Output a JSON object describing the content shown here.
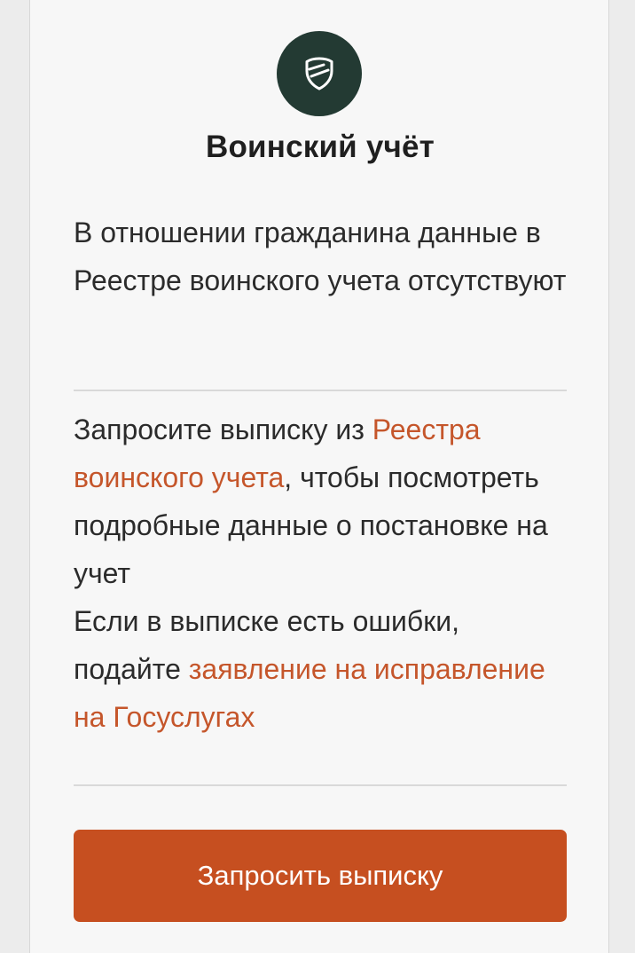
{
  "card": {
    "icon": "shield-icon",
    "title": "Воинский учёт",
    "status_text": "В отношении гражданина данные в Реестре воинского учета отсутствуют",
    "info": {
      "part1": "Запросите выписку из ",
      "registry_link": "Реестра воинского учета",
      "part2": ", чтобы посмотреть подробные данные о постановке на учет",
      "part3": "Если в выписке есть ошибки, подайте ",
      "application_link": "заявление на исправление на Госуслугах"
    },
    "button_label": "Запросить выписку"
  },
  "colors": {
    "icon_bg": "#233a33",
    "accent": "#c64f20",
    "link": "#c5562b"
  }
}
